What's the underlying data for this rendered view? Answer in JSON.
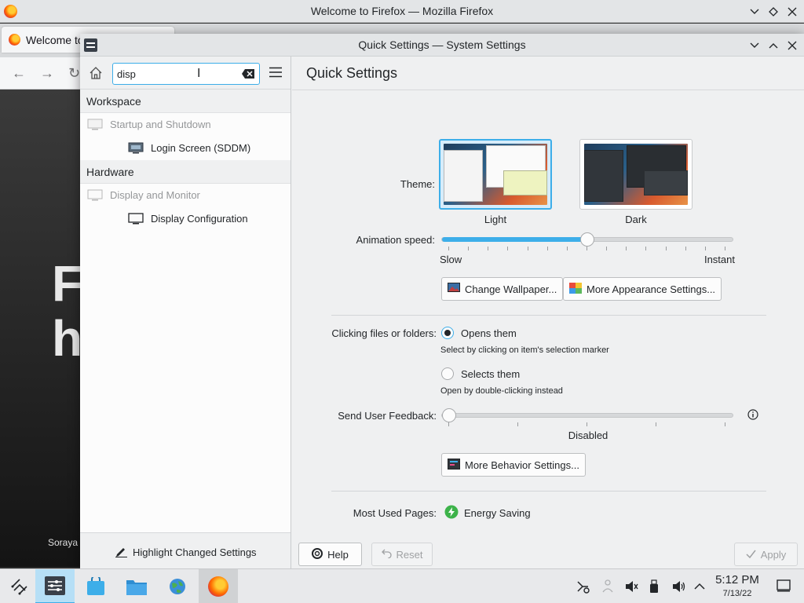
{
  "firefox": {
    "window_title": "Welcome to Firefox — Mozilla Firefox",
    "tab_label": "Welcome to",
    "content_big_1": "F",
    "content_big_2": "h",
    "content_credit": "Soraya"
  },
  "settings": {
    "window_title": "Quick Settings — System Settings",
    "search": {
      "value": "disp"
    },
    "sidebar": {
      "categories": [
        {
          "label": "Workspace"
        },
        {
          "label": "Hardware"
        }
      ],
      "items": [
        {
          "label": "Startup and Shutdown"
        },
        {
          "label": "Login Screen (SDDM)"
        },
        {
          "label": "Display and Monitor"
        },
        {
          "label": "Display Configuration"
        }
      ],
      "highlight_button": "Highlight Changed Settings"
    },
    "main": {
      "title": "Quick Settings",
      "theme_label": "Theme:",
      "themes": [
        {
          "name": "Light",
          "selected": true
        },
        {
          "name": "Dark",
          "selected": false
        }
      ],
      "animation_label": "Animation speed:",
      "animation_level": 0.5,
      "slow_label": "Slow",
      "instant_label": "Instant",
      "change_wallpaper": "Change Wallpaper...",
      "more_appearance": "More Appearance Settings...",
      "clicking_label": "Clicking files or folders:",
      "opens_them": "Opens them",
      "opens_them_hint": "Select by clicking on item's selection marker",
      "selects_them": "Selects them",
      "selects_them_hint": "Open by double-clicking instead",
      "feedback_label": "Send User Feedback:",
      "feedback_level": 0,
      "feedback_value": "Disabled",
      "more_behavior": "More Behavior Settings...",
      "most_used_label": "Most Used Pages:",
      "most_used_item": "Energy Saving"
    },
    "buttons": {
      "help": "Help",
      "reset": "Reset",
      "apply": "Apply"
    }
  },
  "taskbar": {
    "time": "5:12 PM",
    "date": "7/13/22"
  },
  "colors": {
    "accent": "#3daee9",
    "window_bg": "#eff0f1"
  }
}
